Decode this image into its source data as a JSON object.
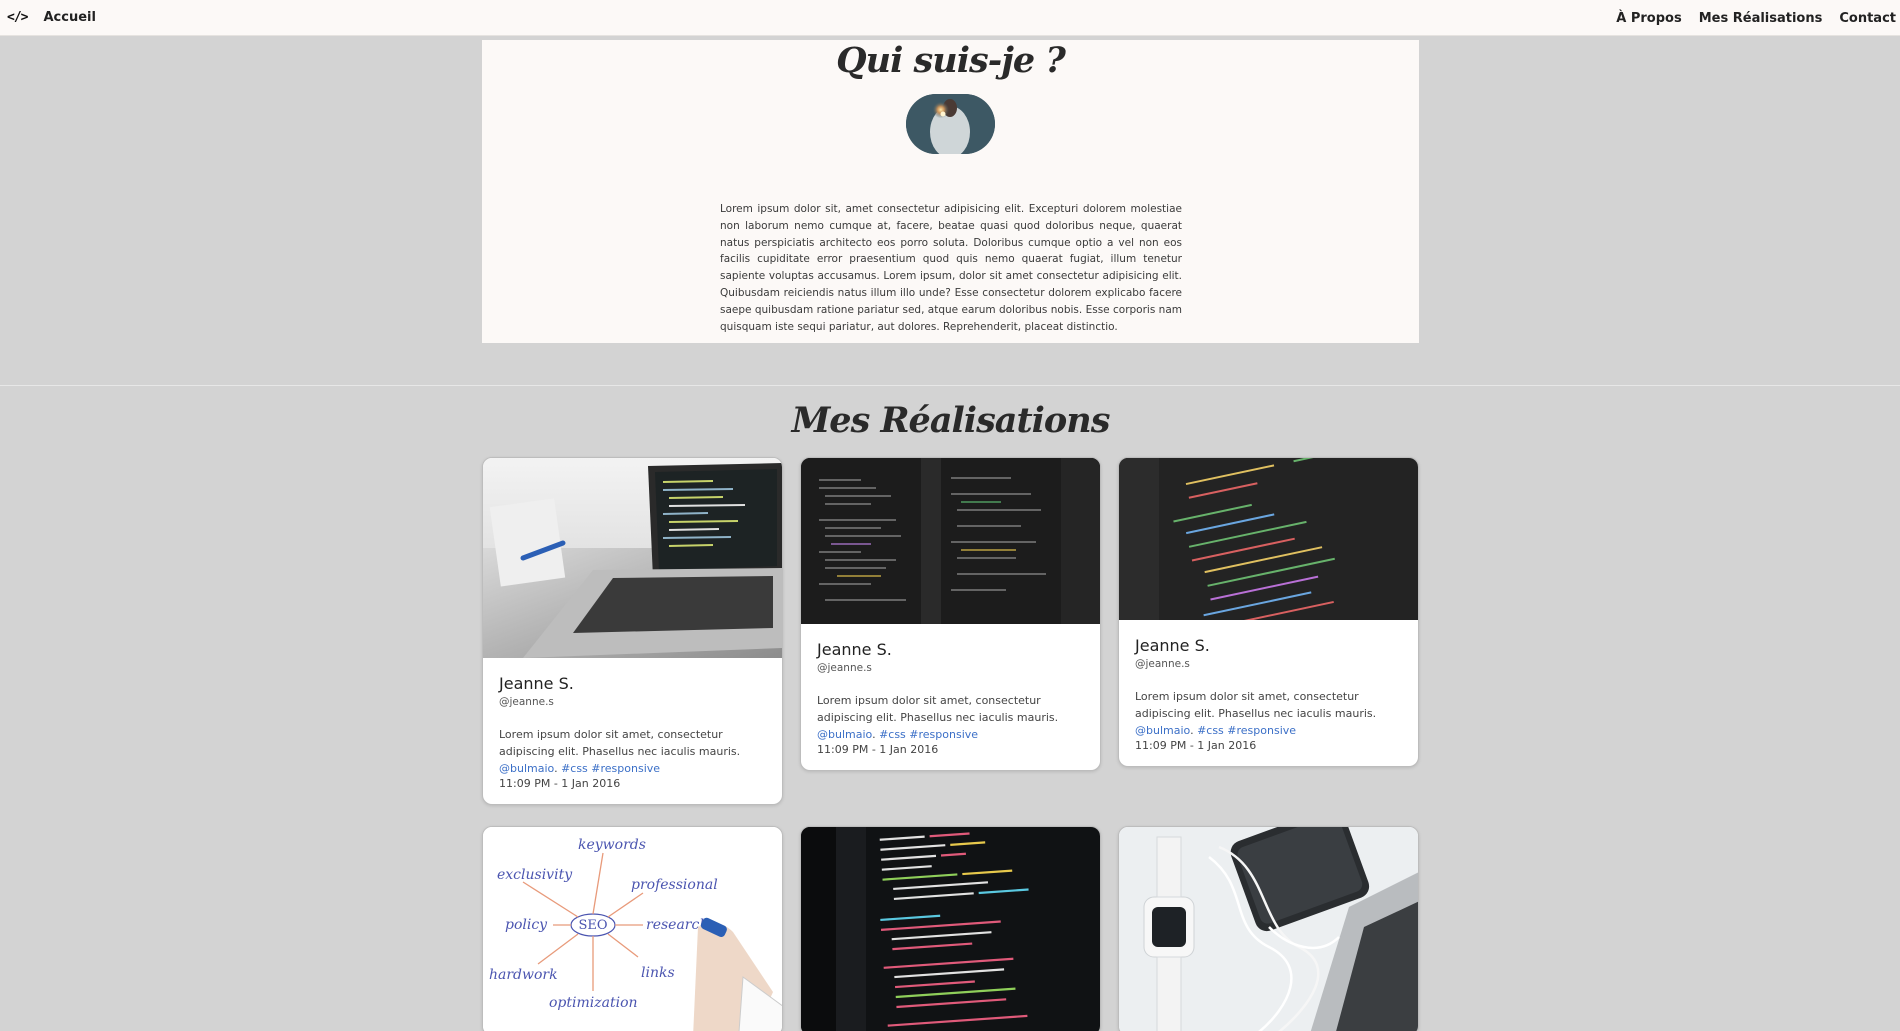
{
  "nav": {
    "logo": "</>",
    "home": "Accueil",
    "links": [
      "À Propos",
      "Mes Réalisations",
      "Contact"
    ]
  },
  "about": {
    "title": "Qui suis-je ?",
    "text": "Lorem ipsum dolor sit, amet consectetur adipisicing elit. Excepturi dolorem molestiae non laborum nemo cumque at, facere, beatae quasi quod doloribus neque, quaerat natus perspiciatis architecto eos porro soluta. Doloribus cumque optio a vel non eos facilis cupiditate error praesentium quod quis nemo quaerat fugiat, illum tenetur sapiente voluptas accusamus. Lorem ipsum, dolor sit amet consectetur adipisicing elit. Quibusdam reiciendis natus illum illo unde? Esse consectetur dolorem explicabo facere saepe quibusdam ratione pariatur sed, atque earum doloribus nobis. Esse corporis nam quisquam iste sequi pariatur, aut dolores. Reprehenderit, placeat distinctio."
  },
  "projects": {
    "title": "Mes Réalisations",
    "cards": [
      {
        "name": "Jeanne S.",
        "handle": "@jeanne.s",
        "text": "Lorem ipsum dolor sit amet, consectetur adipiscing elit. Phasellus nec iaculis mauris.",
        "mention": "@bulmaio",
        "tag1": "#css",
        "tag2": "#responsive",
        "date": "11:09 PM - 1 Jan 2016"
      },
      {
        "name": "Jeanne S.",
        "handle": "@jeanne.s",
        "text": "Lorem ipsum dolor sit amet, consectetur adipiscing elit. Phasellus nec iaculis mauris.",
        "mention": "@bulmaio",
        "tag1": "#css",
        "tag2": "#responsive",
        "date": "11:09 PM - 1 Jan 2016"
      },
      {
        "name": "Jeanne S.",
        "handle": "@jeanne.s",
        "text": "Lorem ipsum dolor sit amet, consectetur adipiscing elit. Phasellus nec iaculis mauris.",
        "mention": "@bulmaio",
        "tag1": "#css",
        "tag2": "#responsive",
        "date": "11:09 PM - 1 Jan 2016"
      }
    ]
  },
  "seo_image": {
    "center": "SEO",
    "words": [
      "keywords",
      "exclusivity",
      "professional",
      "policy",
      "research",
      "hardwork",
      "links",
      "optimization"
    ]
  },
  "colors": {
    "link": "#3b6fc7",
    "page_bg": "#d3d3d3",
    "panel_bg": "#fcf9f7"
  }
}
